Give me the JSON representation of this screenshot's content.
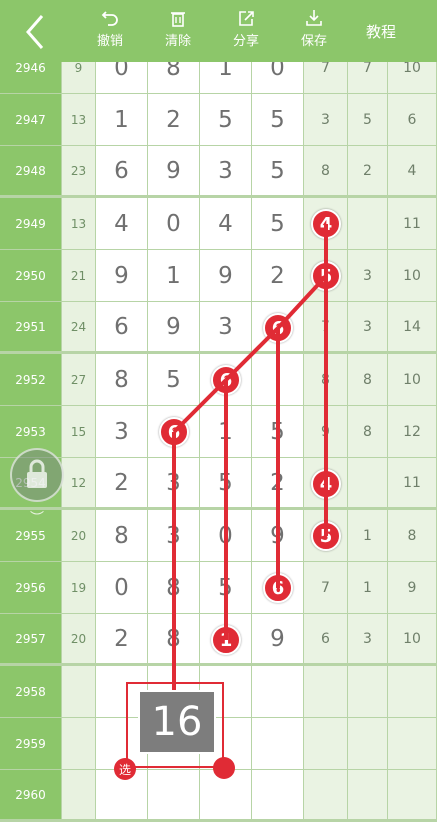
{
  "toolbar": {
    "undo": "撤销",
    "clear": "清除",
    "share": "分享",
    "save": "保存",
    "tutorial": "教程"
  },
  "rows": [
    {
      "issue": "2946",
      "sum": "9",
      "digits": [
        "0",
        "8",
        "1",
        "0"
      ],
      "right": [
        "7",
        "7",
        "10"
      ]
    },
    {
      "issue": "2947",
      "sum": "13",
      "digits": [
        "1",
        "2",
        "5",
        "5"
      ],
      "right": [
        "3",
        "5",
        "6"
      ]
    },
    {
      "issue": "2948",
      "sum": "23",
      "digits": [
        "6",
        "9",
        "3",
        "5"
      ],
      "right": [
        "8",
        "2",
        "4"
      ]
    },
    {
      "issue": "2949",
      "sum": "13",
      "digits": [
        "4",
        "0",
        "4",
        "5"
      ],
      "right": [
        "4",
        "",
        "11"
      ]
    },
    {
      "issue": "2950",
      "sum": "21",
      "digits": [
        "9",
        "1",
        "9",
        "2"
      ],
      "right": [
        "",
        "3",
        "10"
      ]
    },
    {
      "issue": "2951",
      "sum": "24",
      "digits": [
        "6",
        "9",
        "3",
        ""
      ],
      "right": [
        "7",
        "3",
        "14"
      ]
    },
    {
      "issue": "2952",
      "sum": "27",
      "digits": [
        "8",
        "5",
        "",
        ""
      ],
      "right": [
        "8",
        "8",
        "10"
      ]
    },
    {
      "issue": "2953",
      "sum": "15",
      "digits": [
        "3",
        "",
        "1",
        "5"
      ],
      "right": [
        "9",
        "8",
        "12"
      ]
    },
    {
      "issue": "2954",
      "sum": "12",
      "digits": [
        "2",
        "3",
        "5",
        "2"
      ],
      "right": [
        "3",
        "",
        "11"
      ]
    },
    {
      "issue": "2955",
      "sum": "20",
      "digits": [
        "8",
        "3",
        "0",
        "9"
      ],
      "right": [
        "",
        "1",
        "8"
      ]
    },
    {
      "issue": "2956",
      "sum": "19",
      "digits": [
        "0",
        "8",
        "5",
        ""
      ],
      "right": [
        "7",
        "1",
        "9"
      ]
    },
    {
      "issue": "2957",
      "sum": "20",
      "digits": [
        "2",
        "8",
        "",
        "9"
      ],
      "right": [
        "6",
        "3",
        "10"
      ]
    },
    {
      "issue": "2958",
      "sum": "",
      "digits": [
        "",
        "",
        "",
        ""
      ],
      "right": [
        "",
        "",
        ""
      ]
    },
    {
      "issue": "2959",
      "sum": "",
      "digits": [
        "",
        "",
        "",
        ""
      ],
      "right": [
        "",
        "",
        ""
      ]
    },
    {
      "issue": "2960",
      "sum": "",
      "digits": [
        "",
        "",
        "",
        ""
      ],
      "right": [
        "",
        "",
        ""
      ]
    }
  ],
  "balls": [
    {
      "label": "4",
      "row": 3,
      "col": "r0"
    },
    {
      "label": "5",
      "row": 4,
      "col": "r0b"
    },
    {
      "label": "6",
      "row": 5,
      "col": "d3"
    },
    {
      "label": "6",
      "row": 6,
      "col": "d2"
    },
    {
      "label": "6",
      "row": 7,
      "col": "d1"
    },
    {
      "label": "4",
      "row": 8,
      "col": "r0"
    },
    {
      "label": "5",
      "row": 9,
      "col": "r0b"
    },
    {
      "label": "6",
      "row": 10,
      "col": "d3"
    },
    {
      "label": "1",
      "row": 11,
      "col": "d2"
    }
  ],
  "selection": {
    "count": "16",
    "tag": "选"
  },
  "colors": {
    "green_bar": "#8cc66a",
    "left_col": "#8cc66a",
    "sum_col": "#e8f2e0",
    "right_zone": "#eaf3e3",
    "grid_line": "#b7d4a6",
    "ball": "#e02b35"
  }
}
